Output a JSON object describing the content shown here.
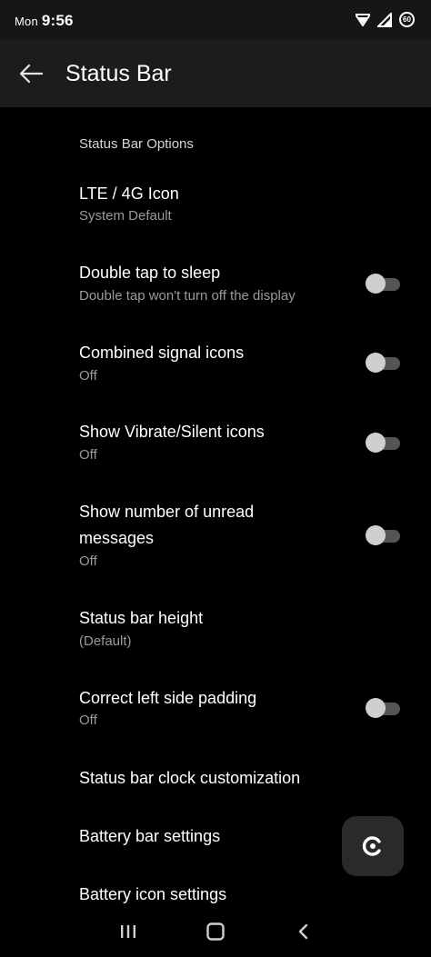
{
  "status_bar": {
    "day": "Mon",
    "time": "9:56",
    "battery_level": "60",
    "icons": [
      "wifi-icon",
      "signal-icon",
      "battery-icon"
    ]
  },
  "app_bar": {
    "title": "Status Bar",
    "back_icon": "arrow-left-icon"
  },
  "section": {
    "header": "Status Bar Options"
  },
  "settings": [
    {
      "title": "LTE / 4G Icon",
      "summary": "System Default",
      "has_switch": false
    },
    {
      "title": "Double tap to sleep",
      "summary": "Double tap won't turn off the display",
      "has_switch": true,
      "checked": false
    },
    {
      "title": "Combined signal icons",
      "summary": "Off",
      "has_switch": true,
      "checked": false
    },
    {
      "title": "Show Vibrate/Silent icons",
      "summary": "Off",
      "has_switch": true,
      "checked": false
    },
    {
      "title_line1": "Show number of unread",
      "title_line2": "messages",
      "summary": "Off",
      "has_switch": true,
      "checked": false
    },
    {
      "title": "Status bar height",
      "summary": "(Default)",
      "has_switch": false
    },
    {
      "title": "Correct left side padding",
      "summary": "Off",
      "has_switch": true,
      "checked": false
    },
    {
      "title": "Status bar clock customization",
      "has_switch": false
    },
    {
      "title": "Battery bar settings",
      "has_switch": false
    },
    {
      "title": "Battery icon settings",
      "has_switch": false
    }
  ],
  "fab": {
    "icon": "custom-rom-logo-icon"
  },
  "nav_bar": {
    "icons": [
      "recents-icon",
      "home-icon",
      "back-icon"
    ]
  },
  "colors": {
    "background": "#000000",
    "app_bar": "#1c1c1c",
    "title_text": "#ffffff",
    "summary_text": "#9a9a9a",
    "switch_track_off": "#555555",
    "switch_thumb_off": "#cfcfcf"
  }
}
